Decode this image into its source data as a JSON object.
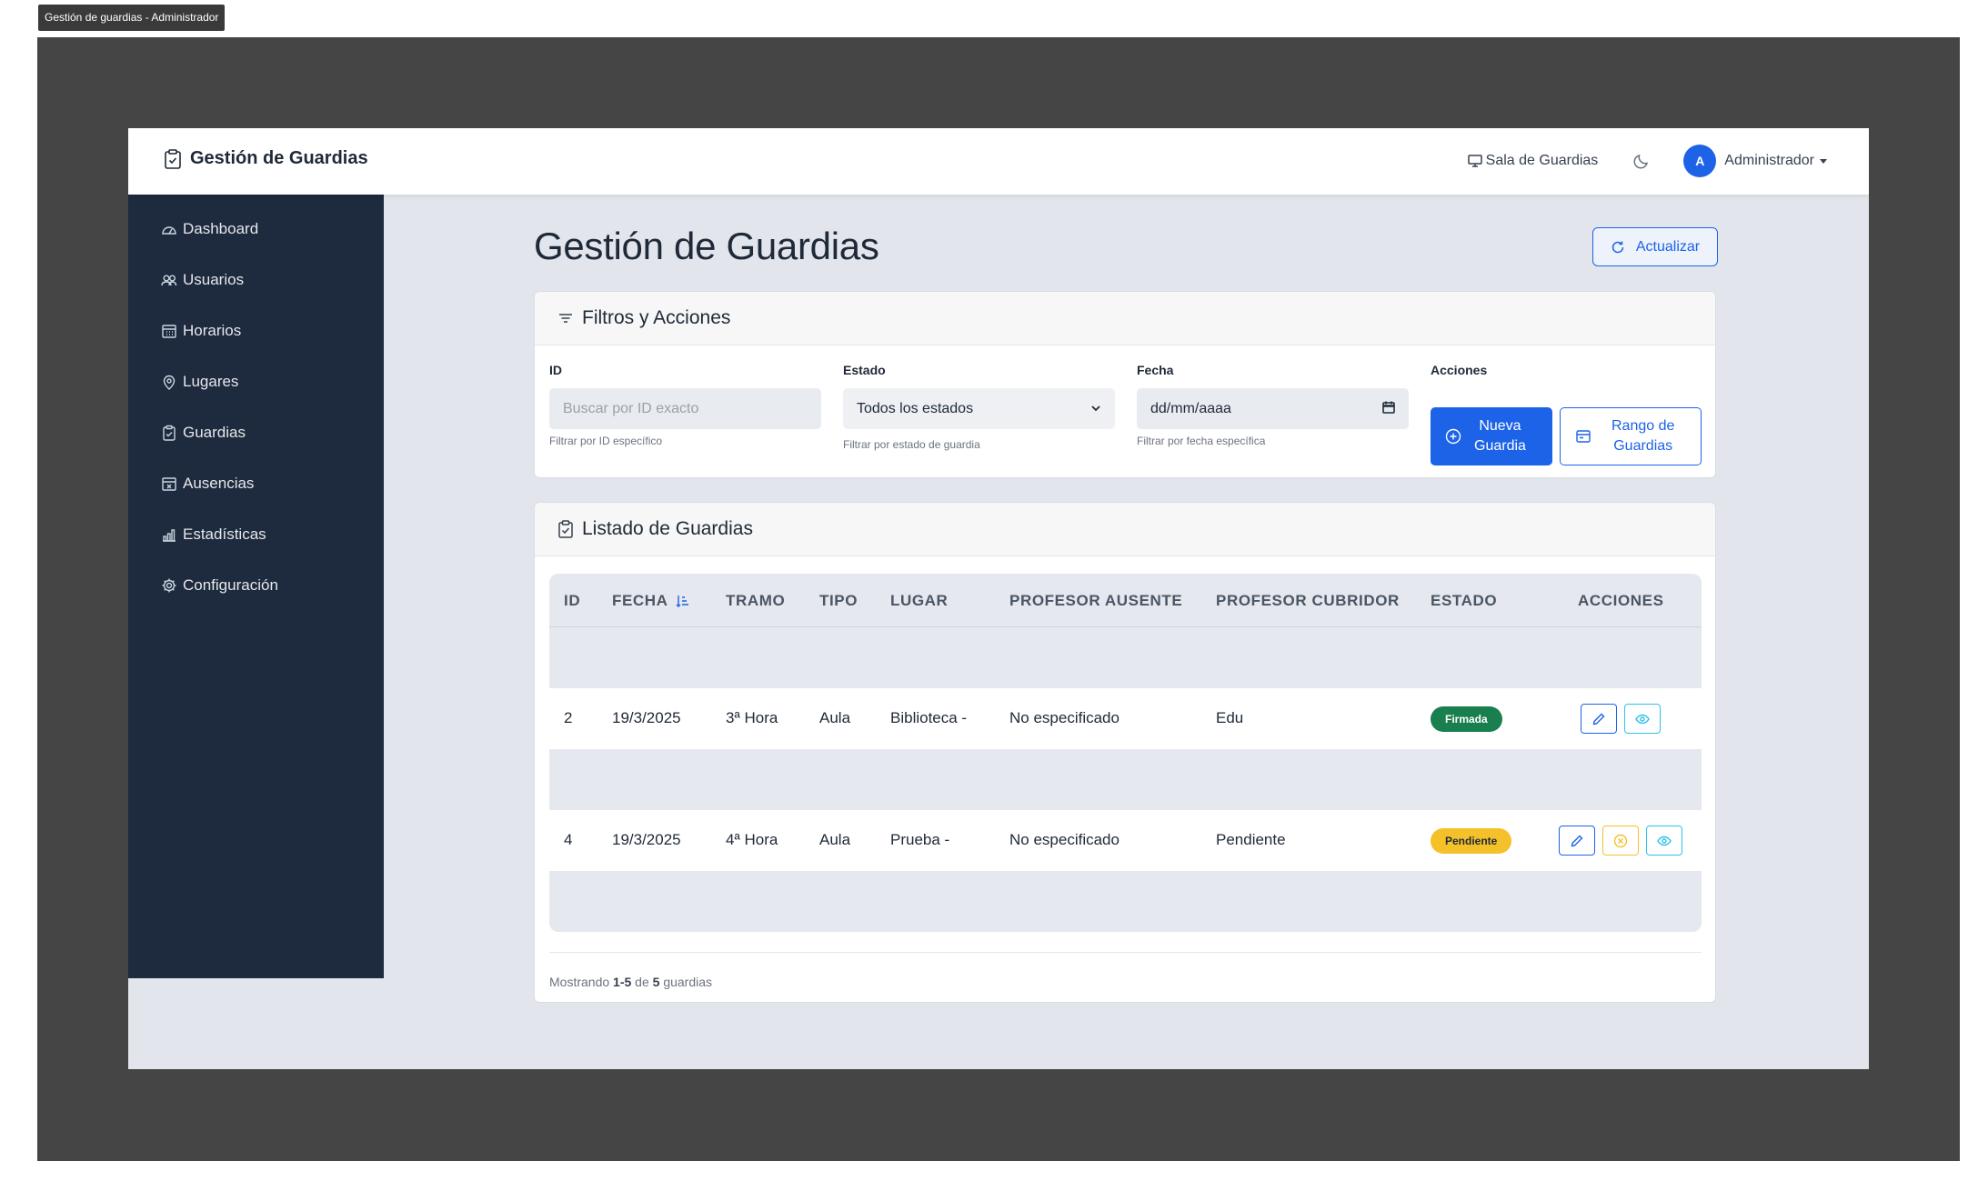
{
  "window": {
    "tab_title": "Gestión de guardias - Administrador"
  },
  "navbar": {
    "brand": "Gestión de Guardias",
    "sala_link": "Sala de Guardias",
    "avatar_initial": "A",
    "user_name": "Administrador"
  },
  "sidebar": {
    "items": [
      {
        "label": "Dashboard",
        "icon": "gauge-icon"
      },
      {
        "label": "Usuarios",
        "icon": "users-icon"
      },
      {
        "label": "Horarios",
        "icon": "calendar-grid-icon"
      },
      {
        "label": "Lugares",
        "icon": "location-pin-icon"
      },
      {
        "label": "Guardias",
        "icon": "clipboard-check-icon"
      },
      {
        "label": "Ausencias",
        "icon": "calendar-x-icon"
      },
      {
        "label": "Estadísticas",
        "icon": "bar-chart-icon"
      },
      {
        "label": "Configuración",
        "icon": "gear-icon"
      }
    ]
  },
  "main": {
    "title": "Gestión de Guardias",
    "refresh_label": "Actualizar"
  },
  "filters": {
    "header": "Filtros y Acciones",
    "id_label": "ID",
    "id_placeholder": "Buscar por ID exacto",
    "id_help": "Filtrar por ID específico",
    "estado_label": "Estado",
    "estado_value": "Todos los estados",
    "estado_help": "Filtrar por estado de guardia",
    "fecha_label": "Fecha",
    "fecha_value": "dd/mm/aaaa",
    "fecha_help": "Filtrar por fecha específica",
    "acciones_label": "Acciones",
    "nueva_line1": "Nueva",
    "nueva_line2": "Guardia",
    "rango_line1": "Rango de",
    "rango_line2": "Guardias"
  },
  "listado": {
    "header": "Listado de Guardias",
    "columns": [
      "ID",
      "FECHA",
      "TRAMO",
      "TIPO",
      "LUGAR",
      "PROFESOR AUSENTE",
      "PROFESOR CUBRIDOR",
      "ESTADO",
      "ACCIONES"
    ],
    "rows": [
      {
        "id": "2",
        "fecha": "19/3/2025",
        "tramo": "3ª Hora",
        "tipo": "Aula",
        "lugar": "Biblioteca -",
        "ausente": "No especificado",
        "cubridor": "Edu",
        "estado": "Firmada",
        "estado_color": "#1a7f4f"
      },
      {
        "id": "4",
        "fecha": "19/3/2025",
        "tramo": "4ª Hora",
        "tipo": "Aula",
        "lugar": "Prueba -",
        "ausente": "No especificado",
        "cubridor": "Pendiente",
        "estado": "Pendiente",
        "estado_color": "#f5c12a"
      }
    ],
    "footer_prefix": "Mostrando",
    "footer_range": "1-5",
    "footer_mid": "de",
    "footer_total": "5",
    "footer_suffix": "guardias"
  },
  "colors": {
    "primary": "#1d63e8",
    "sidebar": "#1e2a3d",
    "success": "#1a7f4f",
    "warning": "#f5c12a",
    "info": "#2ec2e8"
  }
}
